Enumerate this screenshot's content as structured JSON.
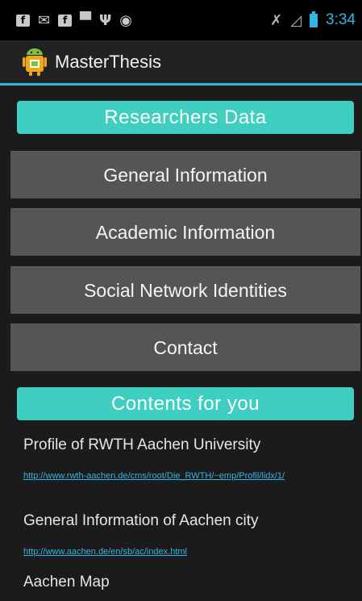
{
  "status_bar": {
    "time": "3:34",
    "icons": [
      "facebook-icon",
      "gmail-icon",
      "facebook-icon",
      "chat-icon",
      "usb-icon",
      "android-debug-icon",
      "no-vibrate-icon",
      "signal-icon",
      "battery-icon"
    ]
  },
  "action_bar": {
    "title": "MasterThesis",
    "icon": "android-app-icon"
  },
  "researchers_header": "Researchers Data",
  "menu": [
    {
      "label": "General Information"
    },
    {
      "label": "Academic Information"
    },
    {
      "label": "Social Network Identities"
    },
    {
      "label": "Contact"
    }
  ],
  "contents_header": "Contents for you",
  "contents": [
    {
      "title": "Profile of RWTH Aachen University",
      "link": "http://www.rwth-aachen.de/cms/root/Die_RWTH/~emp/Profil/lidx/1/"
    },
    {
      "title": "General Information of Aachen city",
      "link": "http://www.aachen.de/en/sb/ac/index.html"
    },
    {
      "title": "Aachen Map",
      "link": ""
    }
  ],
  "colors": {
    "accent": "#33b5e5",
    "header_teal": "#3fcfc0",
    "button_gray": "#555555",
    "background": "#1b1b1b"
  }
}
